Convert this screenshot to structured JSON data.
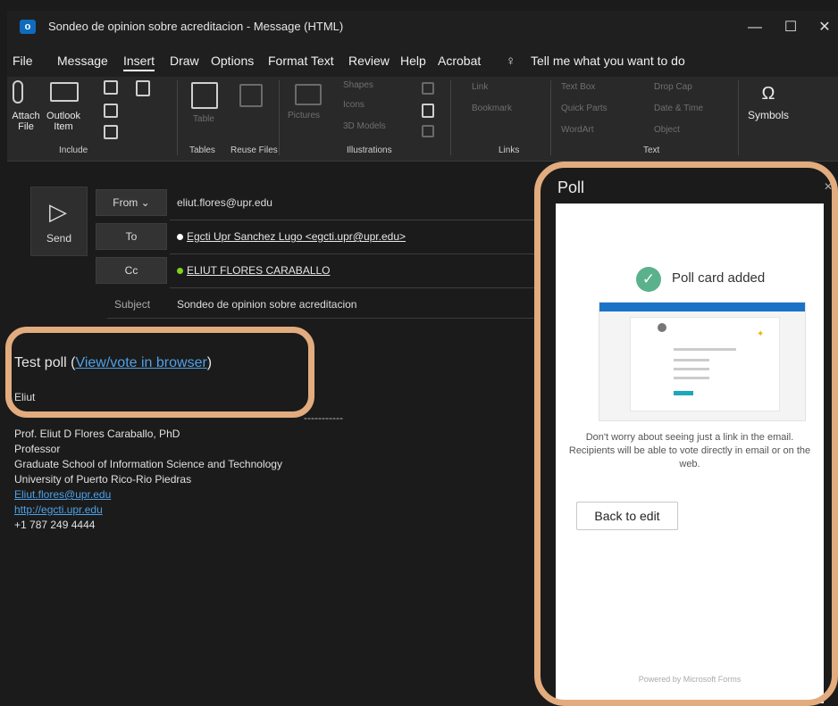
{
  "window": {
    "app_icon": "outlook-icon",
    "title": "Sondeo de opinion sobre acreditacion  -  Message (HTML)",
    "minimize": "—",
    "restore": "☐",
    "close": "✕"
  },
  "menu": {
    "items": [
      "File",
      "Message",
      "Insert",
      "Draw",
      "Options",
      "Format Text",
      "Review",
      "Help",
      "Acrobat"
    ],
    "active": "Insert",
    "tell_me": "Tell me what you want to do"
  },
  "ribbon": {
    "attach_file": "Attach File",
    "outlook_item": "Outlook Item",
    "include_group": "Include",
    "table": "Table",
    "tables_group": "Tables",
    "reuse": "Reuse Files",
    "pictures": "Pictures",
    "shapes": "Shapes",
    "icons": "Icons",
    "models": "3D Models",
    "illustrations_group": "Illustrations",
    "link": "Link",
    "bookmark": "Bookmark",
    "links_group": "Links",
    "textbox": "Text Box",
    "quickparts": "Quick Parts",
    "wordart": "WordArt",
    "dropcap": "Drop Cap",
    "datetime": "Date & Time",
    "object": "Object",
    "text_group": "Text",
    "symbols": "Symbols",
    "symbols_icon": "omega-icon"
  },
  "compose": {
    "send": "Send",
    "from_label": "From ⌄",
    "from_value": "eliut.flores@upr.edu",
    "to_label": "To",
    "to_value": "Egcti Upr Sanchez Lugo <egcti.upr@upr.edu>",
    "cc_label": "Cc",
    "cc_value": "ELIUT FLORES CARABALLO",
    "subject_label": "Subject",
    "subject_value": "Sondeo de opinion sobre acreditacion"
  },
  "body": {
    "poll_prefix": "Test poll (",
    "poll_link": "View/vote in browser",
    "poll_suffix": ")",
    "greeting": "Eliut",
    "dashes": "-----------",
    "signature": [
      "Prof. Eliut D Flores Caraballo, PhD",
      "Professor",
      "Graduate School of Information Science and Technology",
      "University of Puerto Rico-Rio Piedras"
    ],
    "email_link": "Eliut.flores@upr.edu",
    "web_link": "http://egcti.upr.edu",
    "phone": "+1 787 249 4444"
  },
  "poll": {
    "header": "Poll",
    "close": "✕",
    "added": "Poll card added",
    "note": "Don't worry about seeing just a link in the email. Recipients will be able to vote directly in email or on the web.",
    "back": "Back to edit",
    "powered": "Powered by Microsoft Forms"
  },
  "colors": {
    "highlight": "#e2ac7e",
    "link": "#4ea1e8",
    "success": "#5bb18c",
    "accent": "#0f6cbd"
  }
}
